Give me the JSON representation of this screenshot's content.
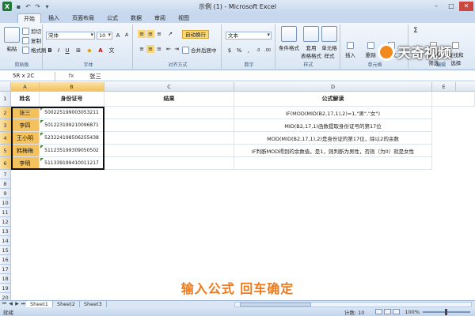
{
  "window": {
    "title": "示例 (1) - Microsoft Excel",
    "app_icon_letter": "X"
  },
  "tabs": [
    "开始",
    "插入",
    "页面布局",
    "公式",
    "数据",
    "审阅",
    "视图"
  ],
  "ribbon": {
    "clipboard": {
      "label": "剪贴板",
      "paste": "粘贴",
      "cut": "剪切",
      "copy": "复制",
      "format_painter": "格式刷"
    },
    "font": {
      "label": "字体",
      "font_name": "宋体",
      "font_size": "10"
    },
    "alignment": {
      "label": "对齐方式",
      "wrap_text": "自动换行",
      "merge_center": "合并后居中"
    },
    "number": {
      "label": "数字",
      "format": "文本"
    },
    "styles": {
      "label": "样式",
      "conditional": "条件格式",
      "table": "套用\n表格格式",
      "cell_styles": "单元格\n样式"
    },
    "cells": {
      "label": "单元格",
      "insert": "插入",
      "delete": "删除",
      "format": "格式"
    },
    "editing": {
      "label": "编辑",
      "sort": "排序和\n筛选",
      "find": "查找和\n选择"
    }
  },
  "watermark": {
    "text": "天奇视频"
  },
  "formula_bar": {
    "name_box": "5R x 2C",
    "fx": "fx",
    "content": "张三"
  },
  "columns": [
    "A",
    "B",
    "C",
    "D",
    "E"
  ],
  "rows": [
    "1",
    "2",
    "3",
    "4",
    "5",
    "6",
    "7",
    "8",
    "9",
    "10",
    "11",
    "12",
    "13",
    "14",
    "15",
    "16",
    "17",
    "18",
    "19",
    "20",
    "21"
  ],
  "headers": {
    "a": "姓名",
    "b": "身份证号",
    "c": "结果",
    "d": "公式解读"
  },
  "data_rows": [
    {
      "name": "张三",
      "id": "500225199003053211",
      "note": "IF(MOD(MID(B2,17,1),2)=1,\"男\",\"女\")"
    },
    {
      "name": "李四",
      "id": "501223199210096871",
      "note": "MID(B2,17,1)函数提取身份证号的第17位"
    },
    {
      "name": "王小明",
      "id": "523224198506255438",
      "note": "MOD(MID(B2,17,1),2)是身份证的第17位，除以2的余数"
    },
    {
      "name": "韩梅梅",
      "id": "511235199309050502",
      "note": "IF判断MOD得到的余数值，是1，则判断为男性，否则（为0）就是女性"
    },
    {
      "name": "李明",
      "id": "511339199410011217",
      "note": ""
    }
  ],
  "caption": "输入公式 回车确定",
  "sheets": [
    "Sheet1",
    "Sheet2",
    "Sheet3"
  ],
  "status": {
    "mode": "就绪",
    "count": "计数: 10",
    "zoom": "100%"
  }
}
